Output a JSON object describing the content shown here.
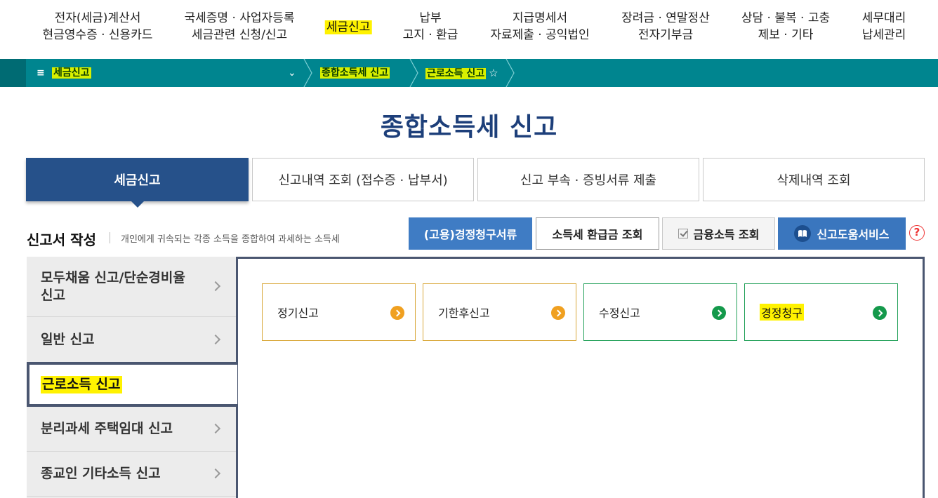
{
  "topnav": {
    "items": [
      {
        "line1": "전자(세금)계산서",
        "line2": "현금영수증 · 신용카드"
      },
      {
        "line1": "국세증명 · 사업자등록",
        "line2": "세금관련 신청/신고"
      },
      {
        "line1": "세금신고",
        "line2": ""
      },
      {
        "line1": "납부",
        "line2": "고지 · 환급"
      },
      {
        "line1": "지급명세서",
        "line2": "자료제출 · 공익법인"
      },
      {
        "line1": "장려금 · 연말정산",
        "line2": "전자기부금"
      },
      {
        "line1": "상담 · 불복 · 고충",
        "line2": "제보 · 기타"
      },
      {
        "line1": "세무대리",
        "line2": "납세관리"
      }
    ]
  },
  "breadcrumb": {
    "menu_icon": "≡",
    "level1": "세금신고",
    "dropdown": "⌄",
    "level2": "종합소득세 신고",
    "level3": "근로소득 신고",
    "star": "☆"
  },
  "page": {
    "title": "종합소득세 신고"
  },
  "tabs": [
    {
      "label": "세금신고",
      "active": true
    },
    {
      "label": "신고내역 조회 (접수증 · 납부서)",
      "active": false
    },
    {
      "label": "신고 부속 · 증빙서류 제출",
      "active": false
    },
    {
      "label": "삭제내역 조회",
      "active": false
    }
  ],
  "section": {
    "title": "신고서 작성",
    "desc": "개인에게 귀속되는 각종 소득을 종합하여 과세하는 소득세"
  },
  "actions": {
    "claim_docs": "(고용)경정청구서류",
    "refund": "소득세 환급금 조회",
    "finance": "금융소득 조회",
    "help_service": "신고도움서비스",
    "help_mark": "?"
  },
  "sidebar": {
    "items": [
      {
        "label": "모두채움 신고/단순경비율 신고"
      },
      {
        "label": "일반 신고"
      },
      {
        "label": "근로소득 신고"
      },
      {
        "label": "분리과세 주택임대 신고"
      },
      {
        "label": "종교인 기타소득 신고"
      }
    ]
  },
  "cards": [
    {
      "label": "정기신고",
      "color": "#f0a020"
    },
    {
      "label": "기한후신고",
      "color": "#f0a020"
    },
    {
      "label": "수정신고",
      "color": "#14994b"
    },
    {
      "label": "경정청구",
      "color": "#14994b"
    }
  ],
  "colors": {
    "brand_navy": "#26518a",
    "teal_bar": "#00858f",
    "highlight": "#fff200"
  }
}
